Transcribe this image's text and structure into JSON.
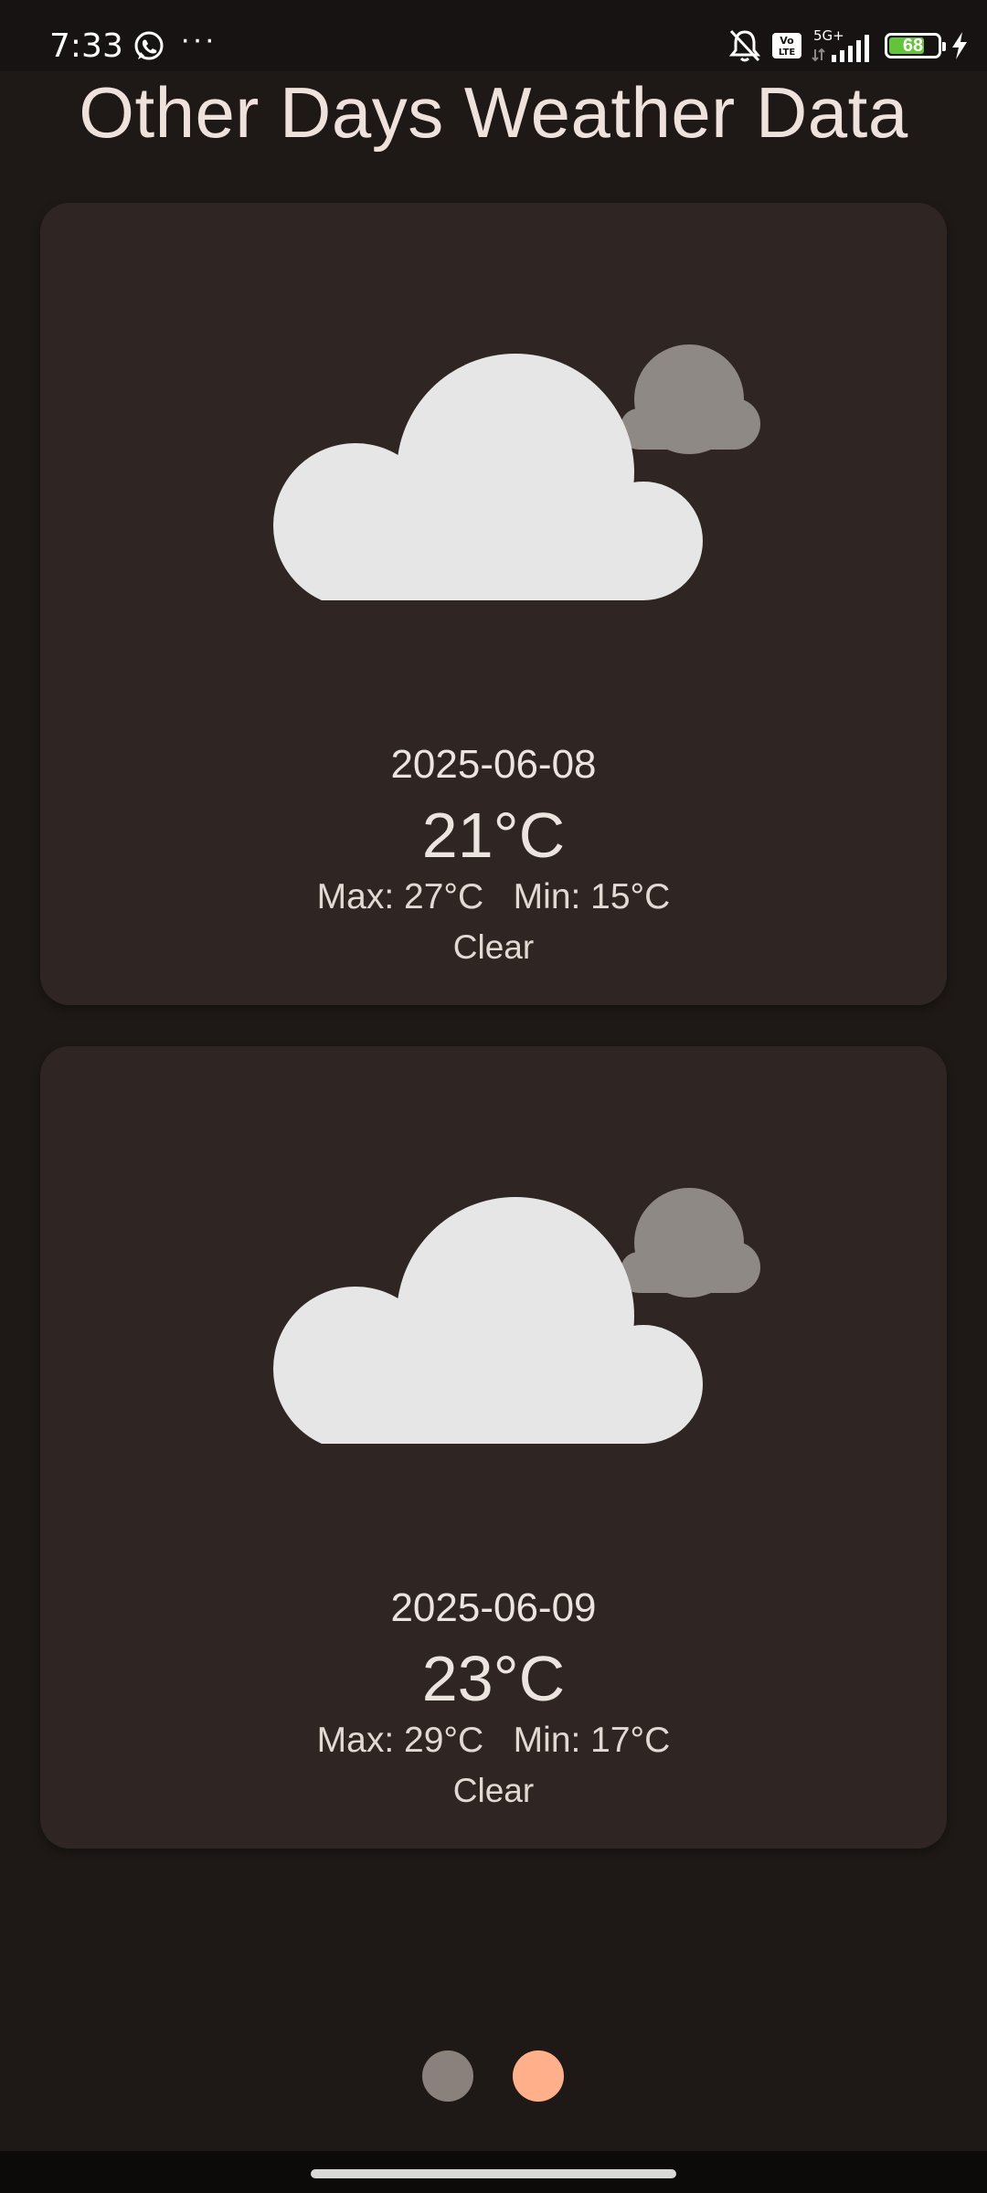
{
  "status_bar": {
    "time": "7:33",
    "icons": [
      "whatsapp-icon",
      "more-dots-icon",
      "bell-off-icon",
      "volte-icon",
      "signal-5g-icon",
      "battery-icon",
      "charging-icon"
    ],
    "dots": "···",
    "volte_label": "Vo LTE",
    "network_label": "5G+",
    "battery": "68",
    "battery_color": "#63c33b"
  },
  "page": {
    "title": "Other Days Weather Data"
  },
  "cards": [
    {
      "date": "2025-06-08",
      "temp": "21°C",
      "max_min": "Max: 27°C   Min: 15°C",
      "condition": "Clear",
      "icon": "cloud-icon"
    },
    {
      "date": "2025-06-09",
      "temp": "23°C",
      "max_min": "Max: 29°C   Min: 17°C",
      "condition": "Clear",
      "icon": "cloud-icon"
    }
  ],
  "pager": {
    "total": 2,
    "active_index": 1,
    "active_color": "#ffb08a",
    "inactive_color": "#8a807c"
  },
  "colors": {
    "background": "#1e1917",
    "card": "#2f2623",
    "cloud_front": "#e6e6e6",
    "cloud_back": "#8f8986"
  }
}
